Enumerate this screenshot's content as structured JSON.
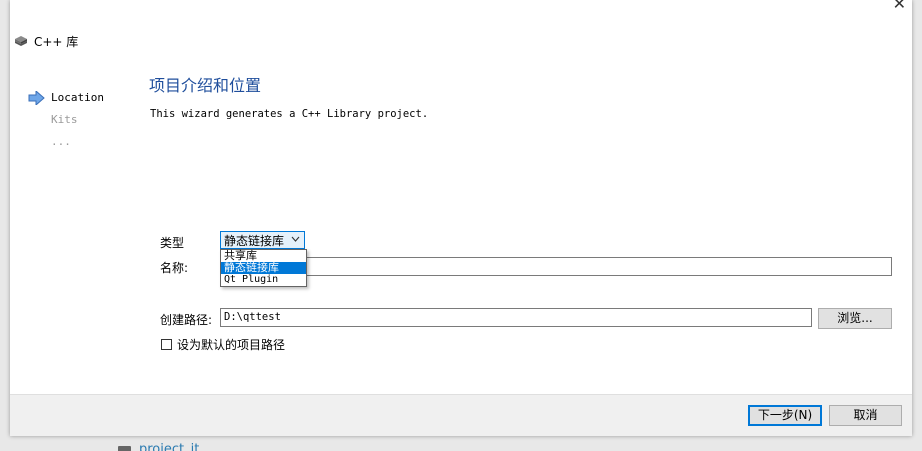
{
  "backdrop": {
    "project_label": "project_it"
  },
  "dialog": {
    "title": "C++ 库",
    "steps": [
      {
        "label": "Location",
        "active": true
      },
      {
        "label": "Kits",
        "active": false
      },
      {
        "label": "...",
        "active": false
      }
    ],
    "page_title": "项目介绍和位置",
    "description": "This wizard generates a C++ Library project.",
    "type_label": "类型",
    "type_value": "静态链接库",
    "type_options": [
      "共享库",
      "静态链接库",
      "Qt Plugin"
    ],
    "type_selected_index": 1,
    "name_label": "名称:",
    "name_value": "",
    "path_label": "创建路径:",
    "path_value": "D:\\qttest",
    "browse_label": "浏览...",
    "default_path_label": "设为默认的项目路径",
    "default_path_checked": false,
    "next_label": "下一步(N)",
    "cancel_label": "取消"
  },
  "icons": {
    "title": "cube-stack-icon",
    "step_active": "arrow-right-icon",
    "combo": "chevron-down-icon",
    "folder": "folder-icon",
    "close": "close-icon"
  },
  "colors": {
    "accent": "#0078d7",
    "title": "#1f4e9c",
    "inactive": "#9a9a9a"
  }
}
